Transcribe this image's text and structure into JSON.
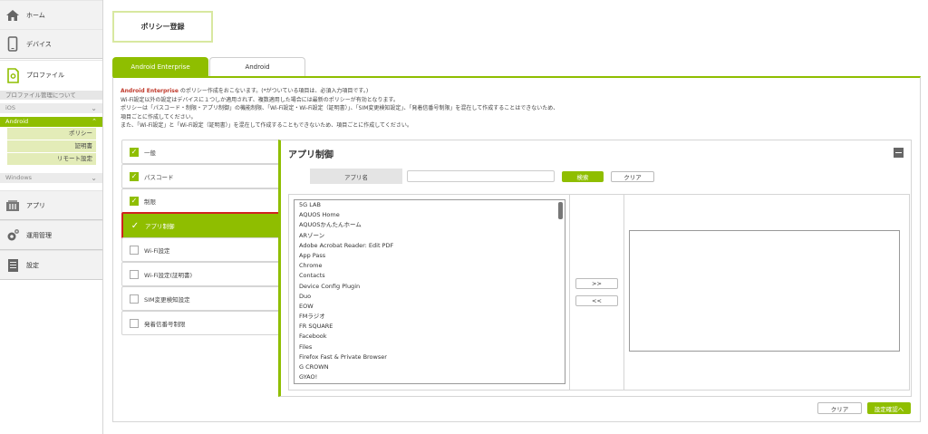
{
  "sidebar": {
    "home": "ホーム",
    "devices": "デバイス",
    "profiles": "プロファイル",
    "profile_about": "プロファイル管理について",
    "ios": "iOS",
    "android": "Android",
    "android_sub": [
      "ポリシー",
      "証明書",
      "リモート設定"
    ],
    "windows": "Windows",
    "apps": "アプリ",
    "operations": "運用管理",
    "settings": "設定"
  },
  "page": {
    "title": "ポリシー登録",
    "tabs": [
      "Android Enterprise",
      "Android"
    ],
    "notes": {
      "line1_hl": "Android Enterprise",
      "line1": "のポリシー作成をおこないます。(*がついている項目は、必須入力項目です。)",
      "line2": "Wi-Fi設定以外の設定はデバイスに１つしか適用されず、複数適用した場合には最新のポリシーが有効となります。",
      "line3": "ポリシーは「パスコード・制限・アプリ制御」の機能制限、「Wi-Fi設定・Wi-Fi設定（証明書）」、「SIM変更検知設定」、「発着信番号制限」を混在して作成することはできないため、",
      "line4": "項目ごとに作成してください。",
      "line5": "また、「Wi-Fi設定」と「Wi-Fi設定（証明書）」を混在して作成することもできないため、項目ごとに作成してください。"
    }
  },
  "checklist": [
    {
      "label": "一般",
      "checked": true
    },
    {
      "label": "パスコード",
      "checked": true
    },
    {
      "label": "制限",
      "checked": true
    },
    {
      "label": "アプリ制御",
      "checked": true,
      "active": true
    },
    {
      "label": "Wi-Fi設定",
      "checked": false
    },
    {
      "label": "Wi-Fi設定(証明書)",
      "checked": false
    },
    {
      "label": "SIM変更検知設定",
      "checked": false
    },
    {
      "label": "発着信番号制限",
      "checked": false
    }
  ],
  "app_control": {
    "title": "アプリ制御",
    "app_name_label": "アプリ名",
    "search_value": "",
    "search_button": "検索",
    "clear_button": "クリア",
    "add_button": ">>",
    "remove_button": "<<",
    "app_list": [
      "5G LAB",
      "AQUOS Home",
      "AQUOSかんたんホーム",
      "ARゾーン",
      "Adobe Acrobat Reader: Edit PDF",
      "App Pass",
      "Chrome",
      "Contacts",
      "Device Config Plugin",
      "Duo",
      "EOW",
      "FMラジオ",
      "FR SQUARE",
      "Facebook",
      "Files",
      "Firefox Fast & Private Browser",
      "G CROWN",
      "GYAO!"
    ]
  },
  "footer": {
    "clear": "クリア",
    "confirm": "設定確認へ"
  },
  "colors": {
    "accent": "#8fbe00",
    "highlight_border": "#d0231f",
    "note_red": "#c0392b"
  }
}
